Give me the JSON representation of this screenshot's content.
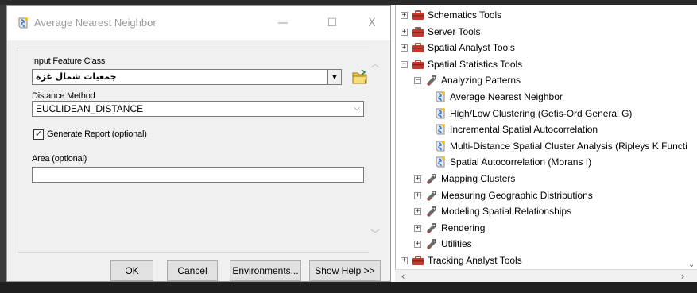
{
  "dialog": {
    "title": "Average Nearest Neighbor",
    "minimize_glyph": "—",
    "maximize_glyph": "☐",
    "close_glyph": "X",
    "input_feature_class_label": "Input Feature Class",
    "input_feature_class_value": "جمعيات شمال غزة",
    "distance_method_label": "Distance Method",
    "distance_method_value": "EUCLIDEAN_DISTANCE",
    "generate_report_label": "Generate Report (optional)",
    "generate_report_checked": true,
    "area_label": "Area (optional)",
    "area_value": "",
    "buttons": {
      "ok": "OK",
      "cancel": "Cancel",
      "environments": "Environments...",
      "show_help": "Show Help >>"
    }
  },
  "tree": {
    "nodes": [
      {
        "label": "Schematics Tools",
        "type": "toolbox",
        "expander": "+"
      },
      {
        "label": "Server Tools",
        "type": "toolbox",
        "expander": "+"
      },
      {
        "label": "Spatial Analyst Tools",
        "type": "toolbox",
        "expander": "+"
      },
      {
        "label": "Spatial Statistics Tools",
        "type": "toolbox",
        "expander": "−"
      },
      {
        "label": "Analyzing Patterns",
        "type": "toolset",
        "expander": "−"
      },
      {
        "label": "Average Nearest Neighbor",
        "type": "tool"
      },
      {
        "label": "High/Low Clustering (Getis-Ord General G)",
        "type": "tool"
      },
      {
        "label": "Incremental Spatial Autocorrelation",
        "type": "tool"
      },
      {
        "label": "Multi-Distance Spatial Cluster Analysis (Ripleys K Functi",
        "type": "tool"
      },
      {
        "label": "Spatial Autocorrelation (Morans I)",
        "type": "tool"
      },
      {
        "label": "Mapping Clusters",
        "type": "toolset",
        "expander": "+"
      },
      {
        "label": "Measuring Geographic Distributions",
        "type": "toolset",
        "expander": "+"
      },
      {
        "label": "Modeling Spatial Relationships",
        "type": "toolset",
        "expander": "+"
      },
      {
        "label": "Rendering",
        "type": "toolset",
        "expander": "+"
      },
      {
        "label": "Utilities",
        "type": "toolset",
        "expander": "+"
      },
      {
        "label": "Tracking Analyst Tools",
        "type": "toolbox",
        "expander": "+"
      }
    ]
  },
  "colors": {
    "toolbox_red": "#c0392b",
    "toolset_gray": "#6a6a6a",
    "tool_blue": "#3a7bd5"
  }
}
